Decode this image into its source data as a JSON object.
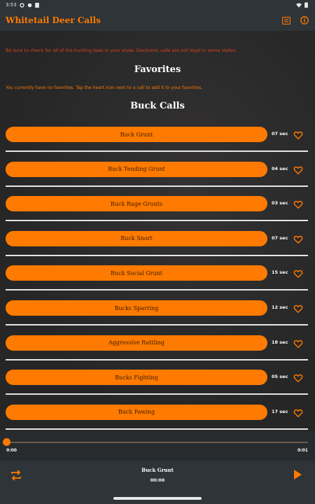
{
  "status": {
    "time": "3:53",
    "icons_left": [
      "gear-icon",
      "circle-icon",
      "square-icon"
    ],
    "icons_right": [
      "wifi-icon",
      "battery-icon"
    ]
  },
  "appbar": {
    "title": "Whitetail Deer Calls",
    "actions": [
      "list-icon",
      "info-icon"
    ]
  },
  "disclaimer": "Be sure to check for all of the hunting laws in your state. Electronic calls are not legal in some states.",
  "favorites": {
    "title": "Favorites",
    "empty_note": "You currently have no favorites. Tap the heart icon next to a call to add it to your favorites."
  },
  "buck_calls": {
    "title": "Buck Calls",
    "items": [
      {
        "label": "Buck Grunt",
        "duration": "07 sec"
      },
      {
        "label": "Buck Tending Grunt",
        "duration": "04 sec"
      },
      {
        "label": "Buck Rage Grunts",
        "duration": "03 sec"
      },
      {
        "label": "Buck Snort",
        "duration": "07 sec"
      },
      {
        "label": "Buck Social Grunt",
        "duration": "15 sec"
      },
      {
        "label": "Bucks Sparring",
        "duration": "12 sec"
      },
      {
        "label": "Aggressive Rattling",
        "duration": "18 sec"
      },
      {
        "label": "Bucks Fighting",
        "duration": "05 sec"
      },
      {
        "label": "Buck Pawing",
        "duration": "17 sec"
      }
    ]
  },
  "player": {
    "elapsed": "0:00",
    "total": "0:01",
    "progress": 0,
    "now_playing": "Buck Grunt",
    "now_time": "00:00"
  },
  "colors": {
    "accent": "#ff7a00",
    "background": "#2a2a2a",
    "bar": "#2e3438",
    "warning": "#e0401f"
  }
}
